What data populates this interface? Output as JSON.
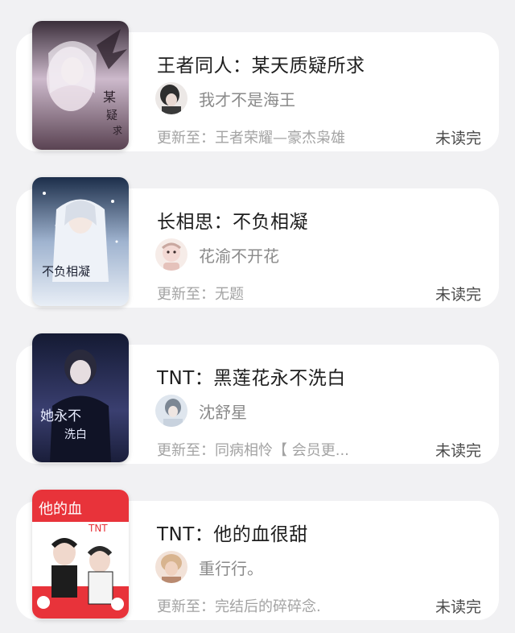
{
  "books": [
    {
      "title": "王者同人：某天质疑所求",
      "author": "我才不是海王",
      "update": "更新至：王者荣耀—豪杰枭雄",
      "status": "未读完",
      "cover_colors": [
        "#3b2f38",
        "#d8c8d6",
        "#8e6e86"
      ],
      "avatar_colors": [
        "#2e2e2e",
        "#e8e4e2"
      ]
    },
    {
      "title": "长相思：不负相凝",
      "author": "花渝不开花",
      "update": "更新至：无题",
      "status": "未读完",
      "cover_colors": [
        "#1c2e4a",
        "#d6e0ef",
        "#5f7fa6"
      ],
      "avatar_colors": [
        "#f3d9d4",
        "#c9a8a0"
      ]
    },
    {
      "title": "TNT：黑莲花永不洗白",
      "author": "沈舒星",
      "update": "更新至：同病相怜【 会员更...",
      "status": "未读完",
      "cover_colors": [
        "#141a33",
        "#8a95c8",
        "#3a3f70"
      ],
      "avatar_colors": [
        "#dfe6ee",
        "#7c8794"
      ]
    },
    {
      "title": "TNT：他的血很甜",
      "author": "重行行。",
      "update": "更新至：完结后的碎碎念.",
      "status": "未读完",
      "cover_colors": [
        "#e8333a",
        "#ffffff",
        "#1d1d1d"
      ],
      "avatar_colors": [
        "#f0d2c0",
        "#b98a70"
      ]
    }
  ]
}
